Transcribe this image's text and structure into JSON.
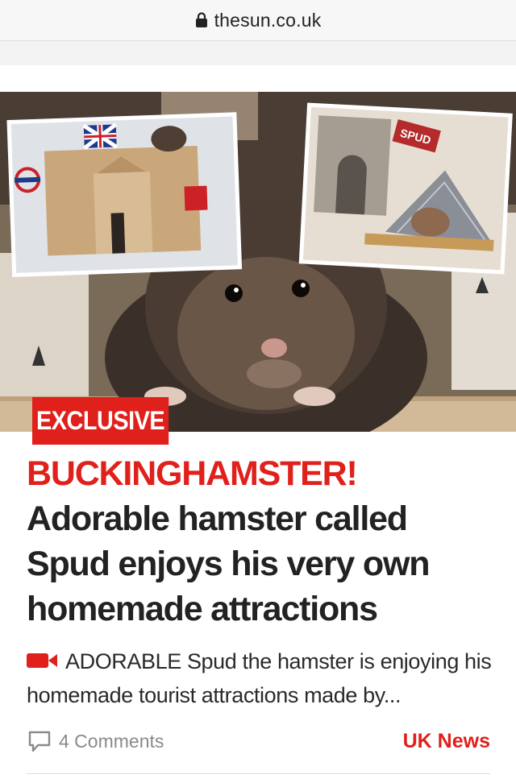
{
  "browser": {
    "url": "thesun.co.uk",
    "lock_icon": "lock-icon"
  },
  "article": {
    "image": {
      "description_icon": "hamster-photo",
      "inset_left_flag": "union-jack",
      "inset_right_sign": "SPUD"
    },
    "badge": "EXCLUSIVE",
    "headline_kicker": "BUCKINGHAMSTER!",
    "headline_rest": " Adorable hamster called Spud enjoys his very own homemade attractions",
    "standfirst": "ADORABLE Spud the hamster is enjoying his homemade tourist attractions made by...",
    "video_icon": "video-camera-icon",
    "comments_label": "4 Comments",
    "comment_icon": "speech-bubble-icon",
    "section": "UK News"
  },
  "colors": {
    "brand_red": "#e0201b",
    "text": "#222222",
    "muted": "#8a8a8a"
  }
}
